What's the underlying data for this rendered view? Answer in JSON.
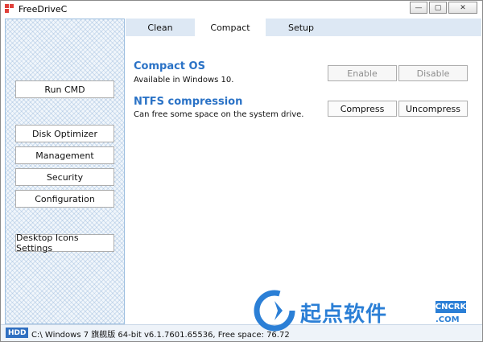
{
  "window": {
    "title": "FreeDriveC"
  },
  "window_controls": {
    "minimize": "—",
    "maximize": "▢",
    "close": "✕"
  },
  "sidebar": {
    "buttons": [
      "Run CMD",
      "Disk Optimizer",
      "Management",
      "Security",
      "Configuration",
      "Desktop Icons Settings"
    ]
  },
  "tabs": {
    "clean": "Clean",
    "compact": "Compact",
    "setup": "Setup",
    "active": "Compact"
  },
  "compact_os": {
    "title": "Compact OS",
    "description": "Available in Windows 10.",
    "enable_label": "Enable",
    "disable_label": "Disable"
  },
  "ntfs": {
    "title": "NTFS compression",
    "description": "Can free some space on the system drive.",
    "compress_label": "Compress",
    "uncompress_label": "Uncompress"
  },
  "status": {
    "badge": "HDD",
    "text": "C:\\ Windows 7 旗舰版  64-bit v6.1.7601.65536, Free space: 76.72"
  },
  "watermark": {
    "text": "起点软件",
    "tag": "CNCRK",
    "domain": ".COM"
  },
  "colors": {
    "accent": "#2a72c6",
    "tab_bar": "#dde8f4",
    "sidebar_pattern": "#9dbfe0"
  }
}
